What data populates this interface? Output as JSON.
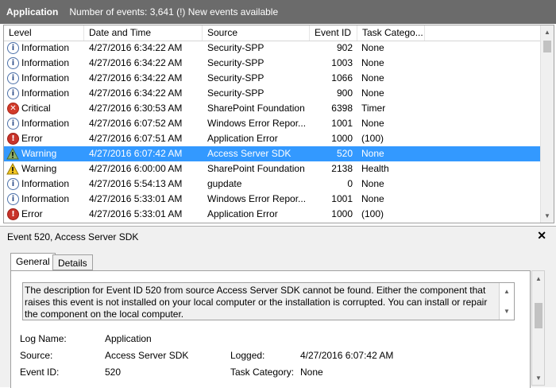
{
  "window": {
    "title": "Application",
    "event_count": "Number of events: 3,641 (!) New events available"
  },
  "columns": {
    "level": "Level",
    "datetime": "Date and Time",
    "source": "Source",
    "event_id": "Event ID",
    "task_category": "Task Catego..."
  },
  "events": [
    {
      "level": "Information",
      "icon": "info-icon",
      "datetime": "4/27/2016 6:34:22 AM",
      "source": "Security-SPP",
      "event_id": "902",
      "task": "None"
    },
    {
      "level": "Information",
      "icon": "info-icon",
      "datetime": "4/27/2016 6:34:22 AM",
      "source": "Security-SPP",
      "event_id": "1003",
      "task": "None"
    },
    {
      "level": "Information",
      "icon": "info-icon",
      "datetime": "4/27/2016 6:34:22 AM",
      "source": "Security-SPP",
      "event_id": "1066",
      "task": "None"
    },
    {
      "level": "Information",
      "icon": "info-icon",
      "datetime": "4/27/2016 6:34:22 AM",
      "source": "Security-SPP",
      "event_id": "900",
      "task": "None"
    },
    {
      "level": "Critical",
      "icon": "critical-icon",
      "datetime": "4/27/2016 6:30:53 AM",
      "source": "SharePoint Foundation",
      "event_id": "6398",
      "task": "Timer"
    },
    {
      "level": "Information",
      "icon": "info-icon",
      "datetime": "4/27/2016 6:07:52 AM",
      "source": "Windows Error Repor...",
      "event_id": "1001",
      "task": "None"
    },
    {
      "level": "Error",
      "icon": "error-icon",
      "datetime": "4/27/2016 6:07:51 AM",
      "source": "Application Error",
      "event_id": "1000",
      "task": "(100)"
    },
    {
      "level": "Warning",
      "icon": "warning-icon",
      "datetime": "4/27/2016 6:07:42 AM",
      "source": "Access Server SDK",
      "event_id": "520",
      "task": "None",
      "selected": true
    },
    {
      "level": "Warning",
      "icon": "warning-icon",
      "datetime": "4/27/2016 6:00:00 AM",
      "source": "SharePoint Foundation",
      "event_id": "2138",
      "task": "Health"
    },
    {
      "level": "Information",
      "icon": "info-icon",
      "datetime": "4/27/2016 5:54:13 AM",
      "source": "gupdate",
      "event_id": "0",
      "task": "None"
    },
    {
      "level": "Information",
      "icon": "info-icon",
      "datetime": "4/27/2016 5:33:01 AM",
      "source": "Windows Error Repor...",
      "event_id": "1001",
      "task": "None"
    },
    {
      "level": "Error",
      "icon": "error-icon",
      "datetime": "4/27/2016 5:33:01 AM",
      "source": "Application Error",
      "event_id": "1000",
      "task": "(100)"
    }
  ],
  "detail": {
    "title": "Event 520, Access Server SDK",
    "close_glyph": "✕",
    "tabs": [
      "General",
      "Details"
    ],
    "description": "The description for Event ID 520 from source Access Server SDK cannot be found. Either the component that raises this event is not installed on your local computer or the installation is corrupted. You can install or repair the component on the local computer.",
    "fields": {
      "log_name_label": "Log Name:",
      "log_name_value": "Application",
      "source_label": "Source:",
      "source_value": "Access Server SDK",
      "logged_label": "Logged:",
      "logged_value": "4/27/2016 6:07:42 AM",
      "event_id_label": "Event ID:",
      "event_id_value": "520",
      "task_category_label": "Task Category:",
      "task_category_value": "None"
    }
  },
  "colors": {
    "title_bar": "#6b6b6b",
    "selection": "#3399ff",
    "panel_bg": "#f0f0f0"
  }
}
